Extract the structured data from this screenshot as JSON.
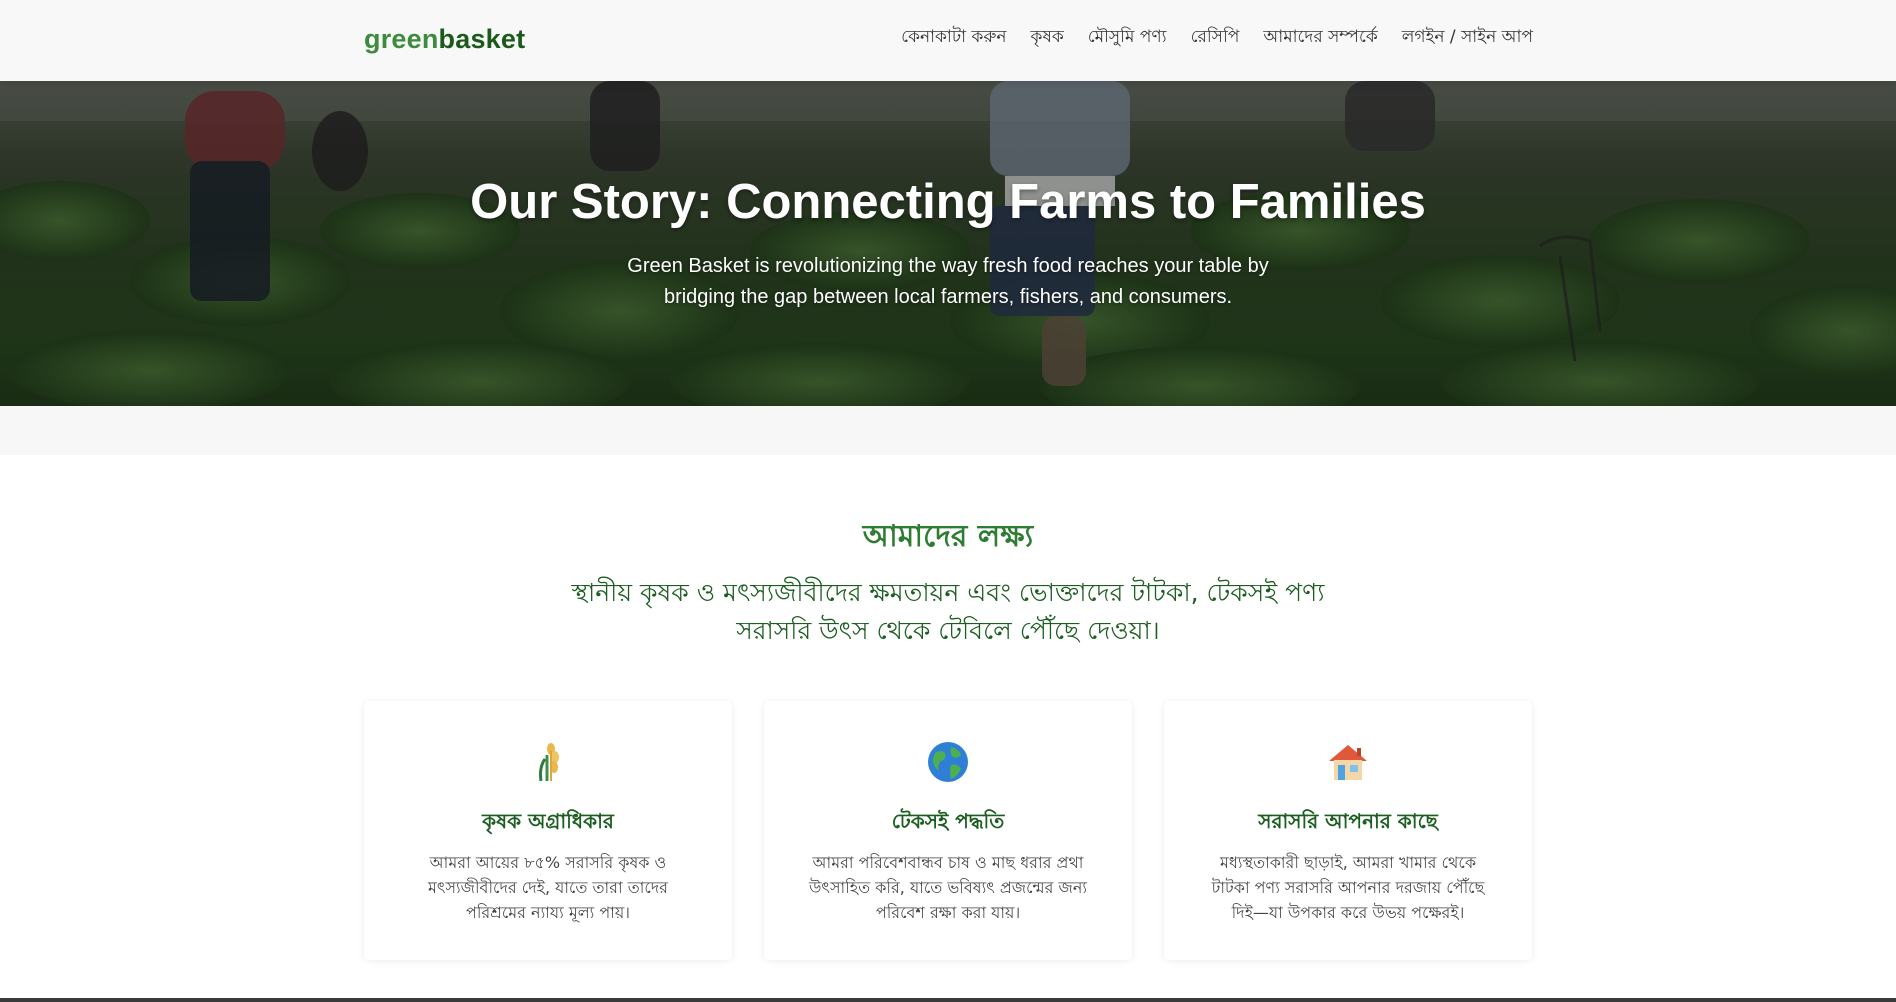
{
  "header": {
    "logo_part1": "green",
    "logo_part2": "basket",
    "nav": [
      {
        "label": "কেনাকাটা করুন"
      },
      {
        "label": "কৃষক"
      },
      {
        "label": "মৌসুমি পণ্য"
      },
      {
        "label": "রেসিপি"
      },
      {
        "label": "আমাদের সম্পর্কে"
      },
      {
        "label": "লগইন / সাইন আপ"
      }
    ]
  },
  "hero": {
    "title": "Our Story: Connecting Farms to Families",
    "subtitle": "Green Basket is revolutionizing the way fresh food reaches your table by bridging the gap between local farmers, fishers, and consumers."
  },
  "mission": {
    "title": "আমাদের লক্ষ্য",
    "text": "স্থানীয় কৃষক ও মৎস্যজীবীদের ক্ষমতায়ন এবং ভোক্তাদের টাটকা, টেকসই পণ্য সরাসরি উৎস থেকে টেবিলে পৌঁছে দেওয়া।"
  },
  "cards": [
    {
      "icon": "wheat-icon",
      "title": "কৃষক অগ্রাধিকার",
      "text": "আমরা আয়ের ৮৫% সরাসরি কৃষক ও মৎস্যজীবীদের দেই, যাতে তারা তাদের পরিশ্রমের ন্যায্য মূল্য পায়।"
    },
    {
      "icon": "globe-icon",
      "title": "টেকসই পদ্ধতি",
      "text": "আমরা পরিবেশবান্ধব চাষ ও মাছ ধরার প্রথা উৎসাহিত করি, যাতে ভবিষ্যৎ প্রজন্মের জন্য পরিবেশ রক্ষা করা যায়।"
    },
    {
      "icon": "house-icon",
      "title": "সরাসরি আপনার কাছে",
      "text": "মধ্যস্থতাকারী ছাড়াই, আমরা খামার থেকে টাটকা পণ্য সরাসরি আপনার দরজায় পৌঁছে দিই—যা উপকার করে উভয় পক্ষেরই।"
    }
  ],
  "colors": {
    "brand_green": "#3d8b3d",
    "brand_dark": "#1c5a1c",
    "heading_green": "#2e7d32"
  }
}
